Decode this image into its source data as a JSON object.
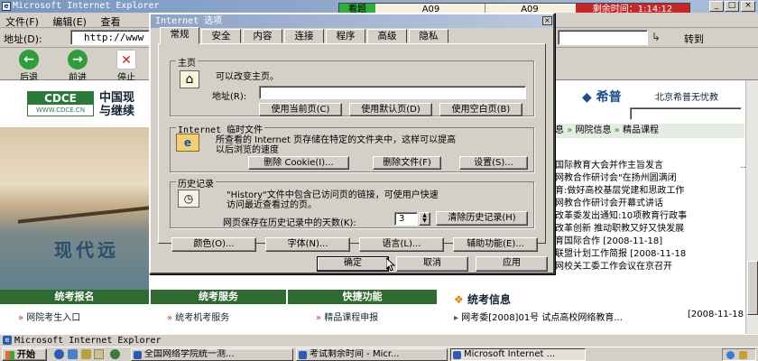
{
  "window": {
    "title": "Microsoft Internet Explorer",
    "controls": [
      "_",
      "□",
      "×"
    ]
  },
  "menu": [
    "文件(F)",
    "编辑(E)",
    "查看"
  ],
  "address": {
    "label": "地址(D):",
    "value": "http://www",
    "go_label": "转到"
  },
  "toolbar": {
    "back": "后退",
    "forward": "前进",
    "stop": "停止"
  },
  "exam_bar": {
    "status": "看题",
    "left_code": "A09",
    "right_code": "A09",
    "timer_label": "剩余时间：",
    "timer_value": "1:14:12"
  },
  "dialog": {
    "title": "Internet 选项",
    "tabs": [
      "常规",
      "安全",
      "内容",
      "连接",
      "程序",
      "高级",
      "隐私"
    ],
    "active_tab": "常规",
    "homepage": {
      "legend": "主页",
      "desc": "可以改变主页。",
      "address_label": "地址(R):",
      "address_value": "",
      "buttons": [
        "使用当前页(C)",
        "使用默认页(D)",
        "使用空白页(B)"
      ]
    },
    "temp": {
      "legend": "Internet 临时文件",
      "desc_line1": "所查看的 Internet 页存储在特定的文件夹中，这样可以提高",
      "desc_line2": "以后浏览的速度",
      "buttons": [
        "删除 Cookie(I)...",
        "删除文件(F)",
        "设置(S)..."
      ]
    },
    "history": {
      "legend": "历史记录",
      "desc_line1": "\"History\"文件中包含已访问页的链接，可使用户快速",
      "desc_line2": "访问最近查看过的页。",
      "days_label": "网页保存在历史记录中的天数(K):",
      "days_value": "3",
      "clear_button": "清除历史记录(H)"
    },
    "bottom_buttons": [
      "颜色(O)...",
      "字体(N)...",
      "语言(L)...",
      "辅助功能(E)..."
    ],
    "ok": "确定",
    "cancel": "取消",
    "apply": "应用"
  },
  "web": {
    "left_logo": "CDCE",
    "left_logo_url": "WWW.CDCE.CN",
    "left_title_1": "中国现",
    "left_title_2": "与继续",
    "banner_text": "现代远",
    "bottom_tabs": [
      "统考报名",
      "统考服务",
      "快捷功能"
    ],
    "bottom_links": [
      "网院考生入口",
      "统考机考服务",
      "精品课程申报"
    ],
    "right_logo": "希普",
    "right_company": "北京希普无忧教",
    "right_nav": [
      "息",
      "网院信息",
      "精品课程"
    ],
    "right_news": [
      "国际教育大会并作主旨发言",
      "网教合作研讨会\"在扬州圆满闭",
      "育:做好高校基层党建和思政工作",
      "网教合作研讨会开幕式讲话",
      "改革委发出通知:10项教育行政事",
      "改革创新  推动职教又好又快发展",
      "育国际合作",
      "联盟计划工作简报",
      "网校关工委工作会议在京召开"
    ],
    "right_news_dates": [
      "[2008-11-18]",
      "[2008-11-18"
    ],
    "right_news_ellipsis": "...",
    "right_section_title": "统考信息",
    "right_section_item": "网考委[2008]01号  试点高校网络教育...",
    "right_section_date": "[2008-11-18"
  },
  "status_bar": {
    "text": "Microsoft Internet Explorer"
  },
  "taskbar": {
    "start": "开始",
    "tasks": [
      "全国网络学院统一测...",
      "考试剩余时间 - Micr...",
      "Microsoft Internet ..."
    ]
  }
}
